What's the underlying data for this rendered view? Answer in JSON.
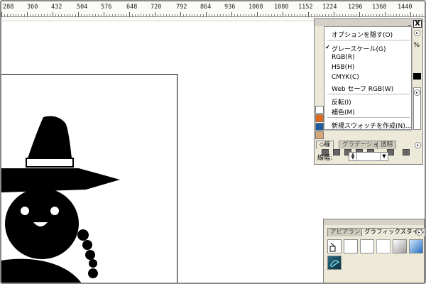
{
  "ruler": {
    "marks": [
      "288",
      "360",
      "432",
      "504",
      "576",
      "648",
      "720",
      "792",
      "864",
      "936",
      "1008",
      "1080",
      "1152",
      "1224",
      "1296",
      "1368",
      "1440"
    ]
  },
  "color_panel": {
    "percent_label": "%",
    "close_glyph": "X",
    "minimize_glyph": "_"
  },
  "flyout_menu": {
    "items": [
      {
        "label": "オプションを隠す(O)",
        "checked": false
      },
      {
        "label": "グレースケール(G)",
        "checked": true
      },
      {
        "label": "RGB(R)",
        "checked": false
      },
      {
        "label": "HSB(H)",
        "checked": false
      },
      {
        "label": "CMYK(C)",
        "checked": false
      },
      {
        "label": "Web セーフ RGB(W)",
        "checked": false
      },
      {
        "label": "反転(I)",
        "checked": false
      },
      {
        "label": "補色(M)",
        "checked": false
      },
      {
        "label": "新規スウォッチを作成(N)...",
        "checked": false
      }
    ],
    "check_glyph": "✔"
  },
  "stroke_panel": {
    "tabs": [
      {
        "label": "◇線",
        "active": true
      },
      {
        "label": "グラデーション",
        "active": false
      },
      {
        "label": "透明",
        "active": false
      }
    ],
    "weight_label": "線幅:"
  },
  "graphic_styles_panel": {
    "tabs": [
      {
        "label": "アピアランス",
        "active": false
      },
      {
        "label": "グラフィックスタイル",
        "active": true
      }
    ]
  },
  "colors": {
    "panel_bg": "#ece9d8",
    "swatch_orange": "#e06a1c",
    "swatch_blue": "#1f5aa0",
    "swatch_tan": "#d6a878",
    "artwork": "#000000"
  }
}
